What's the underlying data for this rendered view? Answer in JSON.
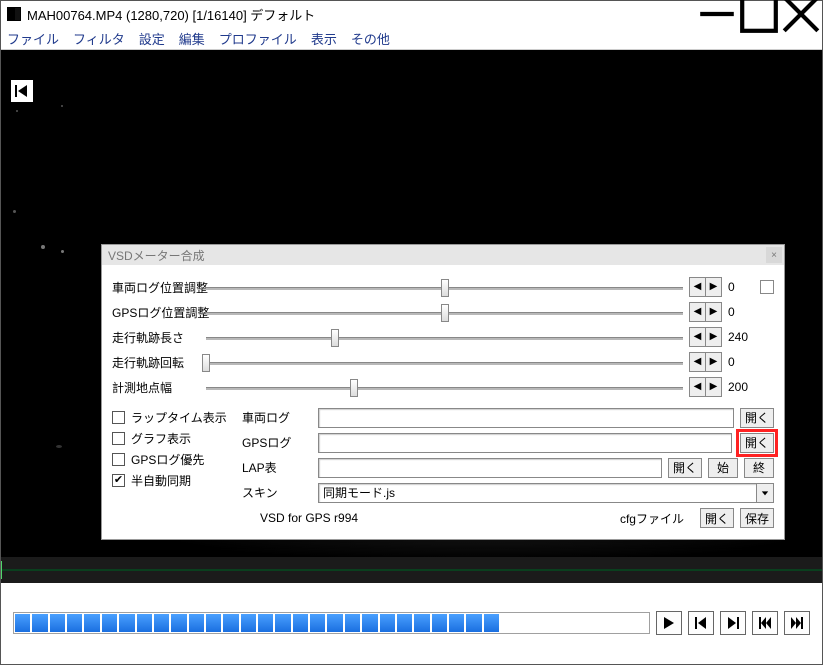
{
  "title": "MAH00764.MP4 (1280,720)  [1/16140]  デフォルト",
  "menu": [
    "ファイル",
    "フィルタ",
    "設定",
    "編集",
    "プロファイル",
    "表示",
    "その他"
  ],
  "dialog": {
    "title": "VSDメーター合成",
    "sliders": [
      {
        "label": "車両ログ位置調整",
        "value": "0",
        "pos": 50
      },
      {
        "label": "GPSログ位置調整",
        "value": "0",
        "pos": 50
      },
      {
        "label": "走行軌跡長さ",
        "value": "240",
        "pos": 27
      },
      {
        "label": "走行軌跡回転",
        "value": "0",
        "pos": 0
      },
      {
        "label": "計測地点幅",
        "value": "200",
        "pos": 31
      }
    ],
    "checks": [
      {
        "label": "ラップタイム表示",
        "checked": false
      },
      {
        "label": "グラフ表示",
        "checked": false
      },
      {
        "label": "GPSログ優先",
        "checked": false
      },
      {
        "label": "半自動同期",
        "checked": true
      }
    ],
    "path_labels": {
      "vehicle_log": "車両ログ",
      "gps_log": "GPSログ",
      "lap_table": "LAP表",
      "skin": "スキン"
    },
    "buttons": {
      "open": "開く",
      "start": "始",
      "end": "終",
      "save": "保存"
    },
    "skin_value": "同期モード.js",
    "version": "VSD for GPS r994",
    "cfg_label": "cfgファイル"
  }
}
